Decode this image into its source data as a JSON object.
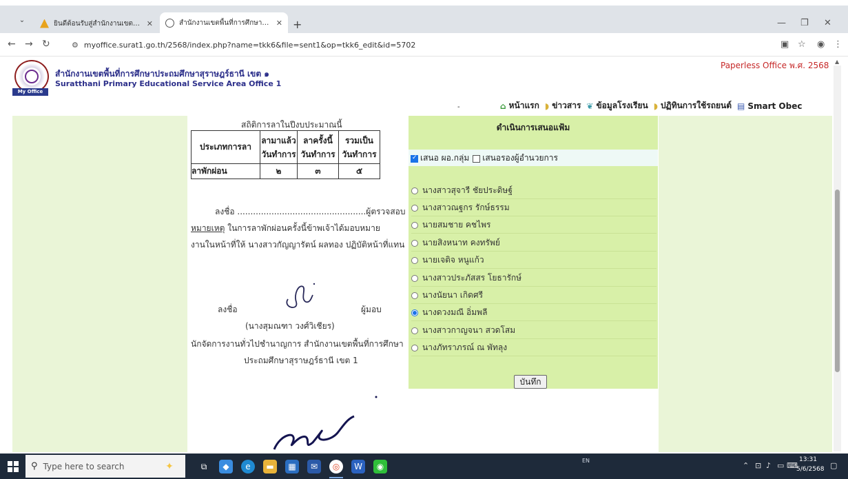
{
  "browser": {
    "tabs": [
      {
        "label": "ยินดีต้อนรับสู่สำนักงานเขตพื้นที่การศึ",
        "icon": "yellow-triangle-icon"
      },
      {
        "label": "สำนักงานเขตพื้นที่การศึกษาประถมศึ",
        "icon": "globe-icon"
      }
    ],
    "new_tab": "+",
    "url": "myoffice.surat1.go.th/2568/index.php?name=tkk6&file=sent1&op=tkk6_edit&id=5702"
  },
  "header": {
    "org_th": "สำนักงานเขตพื้นที่การศึกษาประถมศึกษาสุราษฎร์ธานี เขต ๑",
    "org_en": "Suratthani Primary Educational Service Area Office 1",
    "logo_badge": "My Office",
    "paperless": "Paperless Office พ.ศ. 2568",
    "nav": [
      {
        "label": "หน้าแรก",
        "icon": "home-icon"
      },
      {
        "label": "ข่าวสาร",
        "icon": "folder-icon"
      },
      {
        "label": "ข้อมูลโรงเรียน",
        "icon": "leaf-icon"
      },
      {
        "label": "ปฏิทินการใช้รถยนต์",
        "icon": "folder-icon"
      },
      {
        "label": "Smart Obec",
        "icon": "book-icon"
      }
    ]
  },
  "document": {
    "stat_title": "สถิติการลาในปีงบประมาณนี้",
    "table": {
      "h_type": "ประเภทการลา",
      "h_taken": [
        "ลามาแล้ว",
        "วันทำการ"
      ],
      "h_this": [
        "ลาครั้งนี้",
        "วันทำการ"
      ],
      "h_total": [
        "รวมเป็น",
        "วันทำการ"
      ],
      "row": {
        "type": "ลาพักผ่อน",
        "taken": "๒",
        "this": "๓",
        "total": "๕"
      }
    },
    "sign_line": "ลงชื่อ .................................................ผู้ตรวจสอบ",
    "note_label": "หมายเหตุ",
    "note_text1": " ในการลาพักผ่อนครั้งนี้ข้าพเจ้าได้มอบหมาย",
    "note_text2": "งานในหน้าที่ให้ นางสาวกัญญารัตน์ ผลทอง ปฏิบัติหน้าที่แทน",
    "sign_label": "ลงชื่อ",
    "assign_label": "ผู้มอบ",
    "signer_name": "(นางสุมณฑา วงศ์วิเชียร)",
    "signer_pos1": "นักจัดการงานทั่วไปชำนาญการ สำนักงานเขตพื้นที่การศึกษา",
    "signer_pos2": "ประถมศึกษาสุราษฎร์ธานี เขต 1"
  },
  "form": {
    "title": "ดำเนินการเสนอแฟ้ม",
    "check1": {
      "label": "เสนอ ผอ.กลุ่ม",
      "checked": true
    },
    "check2": {
      "label": "เสนอรองผู้อำนวยการ",
      "checked": false
    },
    "options": [
      {
        "label": "นางสาวสุจารี ชัยประดิษฐ์",
        "selected": false
      },
      {
        "label": "นางสาวณฐกร รักษ์ธรรม",
        "selected": false
      },
      {
        "label": "นายสมชาย คชไพร",
        "selected": false
      },
      {
        "label": "นายสิงหนาท คงทรัพย์",
        "selected": false
      },
      {
        "label": "นายเจติจ หนูแก้ว",
        "selected": false
      },
      {
        "label": "นางสาวประภัสสร โยธารักษ์",
        "selected": false
      },
      {
        "label": "นางนัยนา เกิดศรี",
        "selected": false
      },
      {
        "label": "นางดวงมณี อิ่มพลี",
        "selected": true
      },
      {
        "label": "นางสาวกาญจนา สวดโสม",
        "selected": false
      },
      {
        "label": "นางภัทราภรณ์ ณ พัทลุง",
        "selected": false
      }
    ],
    "save_label": "บันทึก"
  },
  "taskbar": {
    "search_placeholder": "Type here to search",
    "lang": "EN",
    "time": "13:31",
    "date": "5/6/2568"
  }
}
